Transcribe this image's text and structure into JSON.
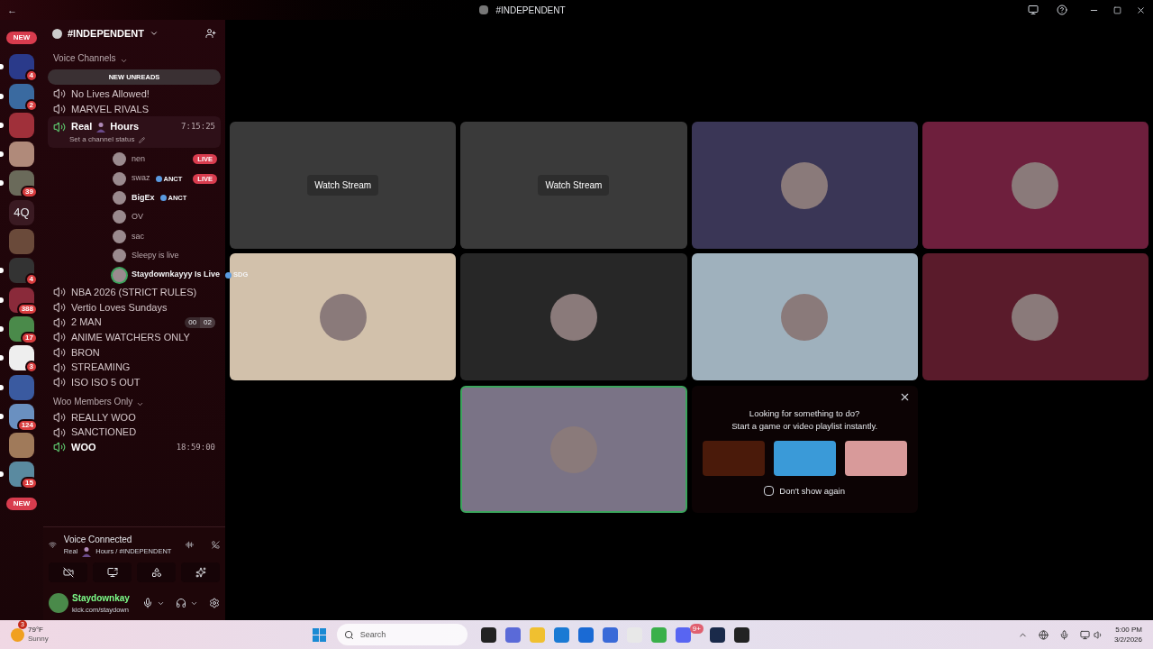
{
  "window": {
    "back": "←",
    "title": "#INDEPENDENT"
  },
  "servers": [
    {
      "kind": "pill",
      "label": "NEW"
    },
    {
      "kind": "photo",
      "unread": true,
      "badge": "4"
    },
    {
      "kind": "photo",
      "unread": true,
      "badge": "2"
    },
    {
      "kind": "photo",
      "unread": true
    },
    {
      "kind": "photo",
      "unread": true
    },
    {
      "kind": "photo",
      "unread": true,
      "badge": "39"
    },
    {
      "kind": "text",
      "unread": false,
      "label": "4Q"
    },
    {
      "kind": "photo",
      "unread": false
    },
    {
      "kind": "photo",
      "unread": true,
      "badge": "4"
    },
    {
      "kind": "photo",
      "unread": true,
      "badge": "388"
    },
    {
      "kind": "photo",
      "unread": true,
      "badge": "17"
    },
    {
      "kind": "photo",
      "unread": true,
      "badge": "3"
    },
    {
      "kind": "photo",
      "unread": true
    },
    {
      "kind": "photo",
      "unread": true,
      "badge": "124"
    },
    {
      "kind": "photo",
      "unread": false
    },
    {
      "kind": "photo",
      "unread": true,
      "badge": "15"
    },
    {
      "kind": "pill",
      "label": "NEW"
    }
  ],
  "server_header": {
    "name": "#INDEPENDENT"
  },
  "new_unreads": "NEW UNREADS",
  "channels": [
    {
      "kind": "category",
      "name": "Voice Channels"
    },
    {
      "kind": "unreads"
    },
    {
      "kind": "channel",
      "name": "No Lives Allowed!",
      "active": false
    },
    {
      "kind": "channel",
      "name": "MARVEL RIVALS",
      "active": false
    },
    {
      "kind": "channel",
      "name": "Real",
      "name_2": "Hours",
      "active": true,
      "selected": true,
      "timer": "7:15:25",
      "status": "Set a channel status",
      "members": [
        {
          "name": "nen",
          "live": "LIVE",
          "speaking": false,
          "bold": false
        },
        {
          "name": "swaz",
          "tag": "ANCT",
          "live": "LIVE",
          "speaking": false,
          "bold": false
        },
        {
          "name": "BigEx",
          "tag": "ANCT",
          "speaking": false,
          "bold": true
        },
        {
          "name": "OV",
          "speaking": false,
          "bold": false
        },
        {
          "name": "sac",
          "speaking": false,
          "bold": false
        },
        {
          "name": "Sleepy is live",
          "speaking": false,
          "bold": false
        },
        {
          "name": "Staydownkayyy Is Live",
          "tag": "SDG",
          "speaking": true,
          "bold": true
        }
      ]
    },
    {
      "kind": "channel",
      "name": "NBA 2026 (STRICT RULES)",
      "active": false
    },
    {
      "kind": "channel",
      "name": "Vertio Loves Sundays",
      "active": false
    },
    {
      "kind": "channel",
      "name": "2 MAN",
      "active": false,
      "counts": [
        "00",
        "02"
      ]
    },
    {
      "kind": "channel",
      "name": "ANIME WATCHERS ONLY",
      "active": false
    },
    {
      "kind": "channel",
      "name": "BRON",
      "active": false
    },
    {
      "kind": "channel",
      "name": "STREAMING",
      "active": false
    },
    {
      "kind": "channel",
      "name": "ISO ISO 5 OUT",
      "active": false
    },
    {
      "kind": "category",
      "name": "Woo Members Only"
    },
    {
      "kind": "channel",
      "name": "REALLY WOO",
      "active": false
    },
    {
      "kind": "channel",
      "name": "SANCTIONED",
      "active": false
    },
    {
      "kind": "channel",
      "name": "WOO",
      "active": true,
      "timer": "18:59:00"
    }
  ],
  "voice_panel": {
    "title": "Voice Connected",
    "channel": "Real",
    "channel_2": "Hours / #INDEPENDENT"
  },
  "user_panel": {
    "name": "Staydownkay",
    "status": "kick.com/staydown"
  },
  "tiles": [
    {
      "kind": "stream",
      "button": "Watch Stream",
      "selected": false
    },
    {
      "kind": "stream",
      "button": "Watch Stream",
      "selected": false
    },
    {
      "kind": "user",
      "color": "#3a3656",
      "selected": false
    },
    {
      "kind": "user",
      "color": "#6e1f3d",
      "selected": false
    },
    {
      "kind": "user",
      "color": "#d2c1ab",
      "selected": false
    },
    {
      "kind": "user",
      "color": "#272727",
      "selected": false
    },
    {
      "kind": "user",
      "color": "#9fb1bd",
      "selected": false
    },
    {
      "kind": "user",
      "color": "#5a1b2b",
      "selected": false
    },
    {
      "kind": "empty"
    },
    {
      "kind": "user",
      "color": "#7a7386",
      "selected": true
    }
  ],
  "activity_card": {
    "title": "Looking for something to do?",
    "subtitle": "Start a game or video playlist instantly.",
    "checkbox": {
      "label": "Don't show again",
      "checked": false
    }
  },
  "taskbar": {
    "weather": {
      "temp": "79°F",
      "condition": "Sunny",
      "badge": "3"
    },
    "search": {
      "placeholder": "Search"
    },
    "discord_badge": "9+",
    "time": "5:00 PM",
    "date": "3/2/2026"
  }
}
